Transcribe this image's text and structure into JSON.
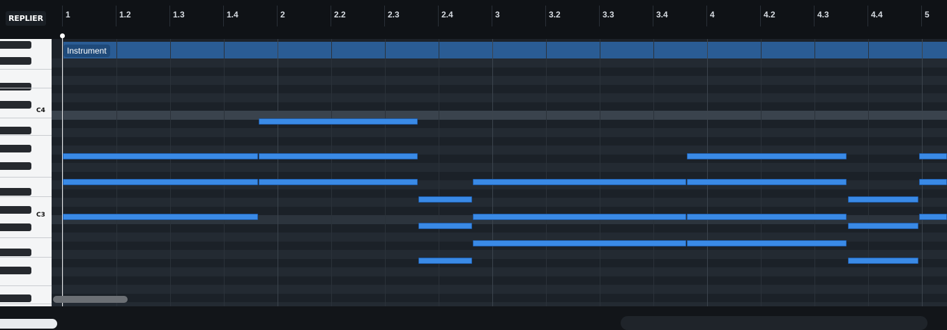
{
  "corner": {
    "button_label": "REPLIER"
  },
  "ruler": {
    "labels": [
      "1",
      "1.2",
      "1.3",
      "1.4",
      "2",
      "2.2",
      "2.3",
      "2.4",
      "3",
      "3.2",
      "3.3",
      "3.4",
      "4",
      "4.2",
      "4.3",
      "4.4",
      "5"
    ]
  },
  "keyboard": {
    "octave_labels": [
      "C4",
      "C3"
    ]
  },
  "region": {
    "label": "Instrument"
  },
  "colors": {
    "accent": "#3a8ae6",
    "region": "#2a5c94",
    "grid_dark": "#1c2229",
    "grid_light": "#232a32"
  }
}
